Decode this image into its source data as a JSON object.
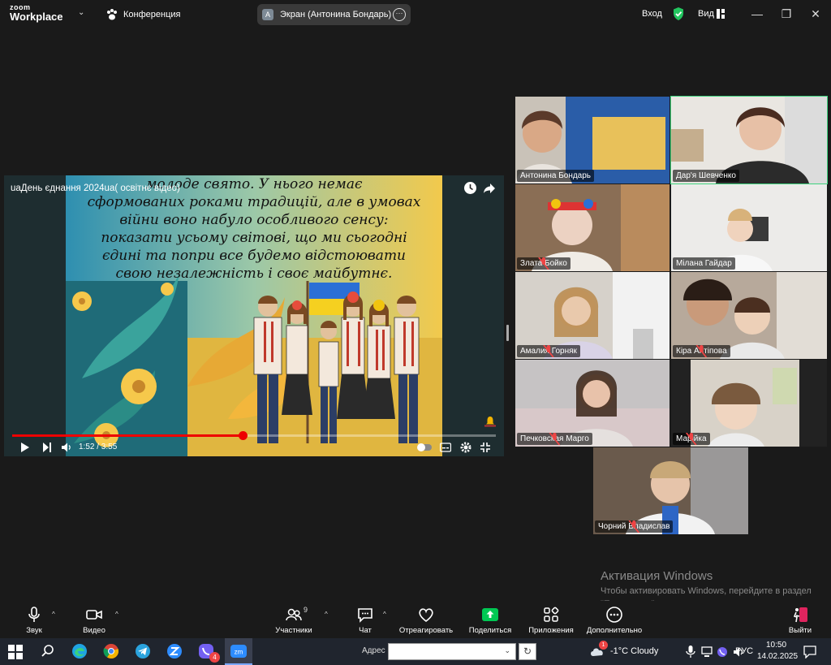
{
  "app": {
    "logo_line1": "zoom",
    "logo_line2": "Workplace"
  },
  "titlebar": {
    "meeting_label": "Конференция",
    "share_avatar_letter": "A",
    "share_label": "Экран (Антонина Бондарь)",
    "signin_label": "Вход",
    "view_label": "Вид"
  },
  "video": {
    "title": "uaДень єднання 2024ua( освітнє відео)",
    "quote": "молоде свято. У нього немає\nсформованих роками традицій, але в умовах\nвійни воно набуло особливого сенсу:\nпоказати усьому світові, що ми сьогодні\nєдині та попри все будемо відстоювати\nсвою незалежність і своє майбутнє.",
    "time": "1:52 / 3:55",
    "progress": 0.4766
  },
  "participants": [
    {
      "name": "Антонина Бондарь",
      "muted": false,
      "active": false
    },
    {
      "name": "Дар'я Шевченко",
      "muted": false,
      "active": true
    },
    {
      "name": "Злата Бойко",
      "muted": true,
      "active": false
    },
    {
      "name": "Мілана Гайдар",
      "muted": false,
      "active": false
    },
    {
      "name": "Амалия Горняк",
      "muted": true,
      "active": false
    },
    {
      "name": "Кіра Антіпова",
      "muted": true,
      "active": false
    },
    {
      "name": "Печковская Марго",
      "muted": true,
      "active": false
    },
    {
      "name": "Марійка",
      "muted": true,
      "active": false
    },
    {
      "name": "Чорний Владислав",
      "muted": true,
      "active": false
    }
  ],
  "watermark": {
    "title": "Активация Windows",
    "subtitle": "Чтобы активировать Windows, перейдите в раздел \"Параметры\"."
  },
  "toolbar": {
    "audio": "Звук",
    "video": "Видео",
    "participants": "Участники",
    "participants_count": "9",
    "chat": "Чат",
    "react": "Отреагировать",
    "share": "Поделиться",
    "apps": "Приложения",
    "more": "Дополнительно",
    "leave": "Выйти"
  },
  "taskbar": {
    "address_label": "Адрес",
    "address_value": "",
    "weather": "-1°C  Cloudy",
    "weather_badge": "1",
    "telegram_badge": "4",
    "language": "РУС",
    "time": "10:50",
    "date": "14.02.2025"
  },
  "colors": {
    "accent_green": "#3fd37f",
    "share_green": "#00c853",
    "progress_red": "#e00000",
    "leave_red": "#e0245e"
  },
  "icons": [
    "search-icon",
    "edge-icon",
    "chrome-icon",
    "telegram-icon",
    "zoom-icon",
    "viber-icon",
    "zoom-meetings-icon",
    "start-icon",
    "shield-icon",
    "clock-icon",
    "share-arrow-icon",
    "mic-icon",
    "camera-icon",
    "participants-icon",
    "chat-icon",
    "heart-icon",
    "share-screen-icon",
    "apps-icon",
    "more-icon",
    "leave-icon",
    "notification-icon",
    "cloud-icon"
  ]
}
